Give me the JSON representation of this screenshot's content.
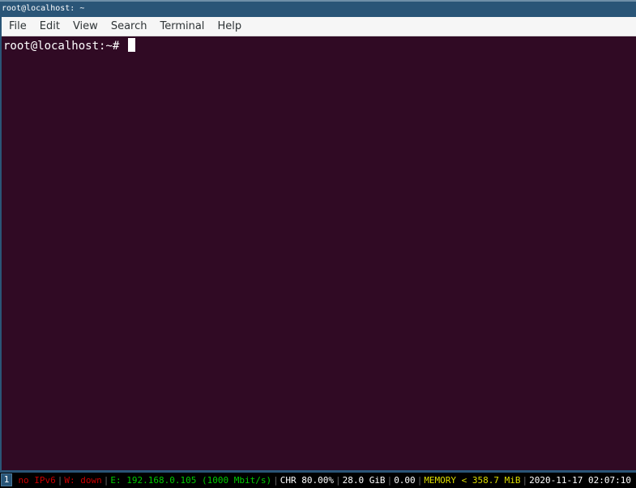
{
  "window": {
    "title": "root@localhost: ~"
  },
  "menubar": {
    "items": [
      "File",
      "Edit",
      "View",
      "Search",
      "Terminal",
      "Help"
    ]
  },
  "terminal": {
    "prompt": "root@localhost:~#",
    "input": " "
  },
  "statusbar": {
    "workspace": "1",
    "blocks": [
      {
        "name": "ipv6",
        "text": "no IPv6",
        "color": "#cc0000"
      },
      {
        "name": "wireless",
        "text": "W: down",
        "color": "#cc0000"
      },
      {
        "name": "ethernet",
        "text": "E: 192.168.0.105 (1000 Mbit/s)",
        "color": "#00cc00"
      },
      {
        "name": "battery",
        "text": "CHR 80.00%",
        "color": "#ffffff"
      },
      {
        "name": "disk",
        "text": "28.0 GiB",
        "color": "#ffffff"
      },
      {
        "name": "load",
        "text": "0.00",
        "color": "#ffffff"
      },
      {
        "name": "memory",
        "text": "MEMORY < 358.7 MiB",
        "color": "#dddd00"
      },
      {
        "name": "datetime",
        "text": "2020-11-17 02:07:10",
        "color": "#ffffff"
      }
    ]
  },
  "colors": {
    "titlebar": "#2a5577",
    "terminal_bg": "#300a24",
    "menubar_bg": "#f6f6f6",
    "status_bg": "#000000"
  }
}
